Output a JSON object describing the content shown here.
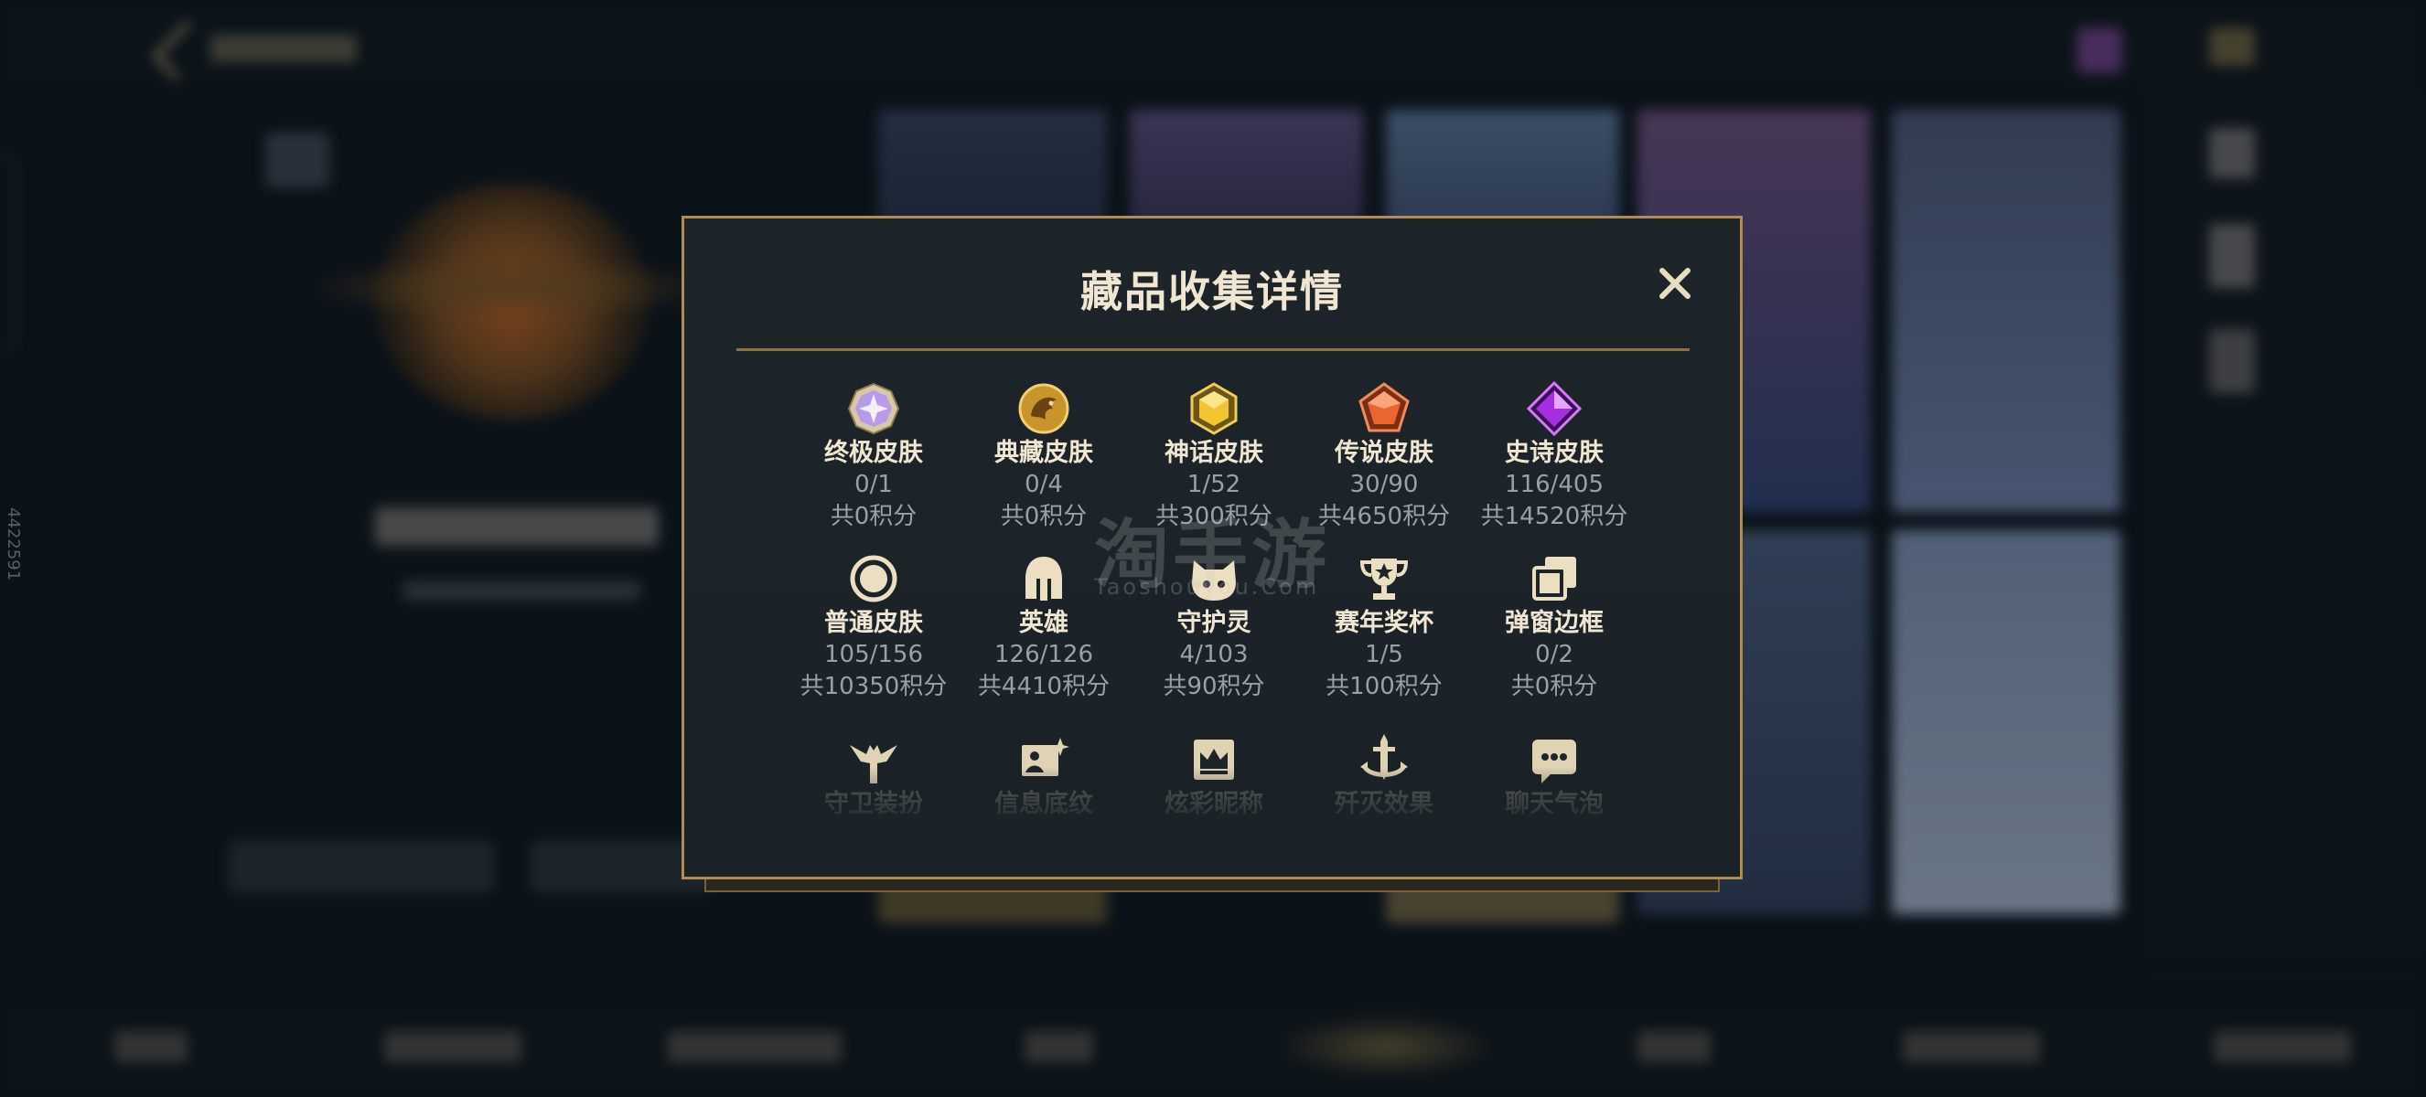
{
  "modal": {
    "title": "藏品收集详情"
  },
  "categories": [
    {
      "name": "终极皮肤",
      "progress": "0/1",
      "points": "共0积分",
      "icon": "ultimate-skin-gem-icon"
    },
    {
      "name": "典藏皮肤",
      "progress": "0/4",
      "points": "共0积分",
      "icon": "dragon-crest-icon"
    },
    {
      "name": "神话皮肤",
      "progress": "1/52",
      "points": "共300积分",
      "icon": "mythic-gem-icon"
    },
    {
      "name": "传说皮肤",
      "progress": "30/90",
      "points": "共4650积分",
      "icon": "legendary-gem-icon"
    },
    {
      "name": "史诗皮肤",
      "progress": "116/405",
      "points": "共14520积分",
      "icon": "epic-gem-icon"
    },
    {
      "name": "普通皮肤",
      "progress": "105/156",
      "points": "共10350积分",
      "icon": "ring-icon"
    },
    {
      "name": "英雄",
      "progress": "126/126",
      "points": "共4410积分",
      "icon": "helmet-icon"
    },
    {
      "name": "守护灵",
      "progress": "4/103",
      "points": "共90积分",
      "icon": "little-legend-icon"
    },
    {
      "name": "赛年奖杯",
      "progress": "1/5",
      "points": "共100积分",
      "icon": "trophy-icon"
    },
    {
      "name": "弹窗边框",
      "progress": "0/2",
      "points": "共0积分",
      "icon": "stacked-frames-icon"
    },
    {
      "name": "守卫装扮",
      "icon": "ward-skin-icon"
    },
    {
      "name": "信息底纹",
      "icon": "banner-sparkle-icon"
    },
    {
      "name": "炫彩昵称",
      "icon": "crown-card-icon"
    },
    {
      "name": "歼灭效果",
      "icon": "anchor-sword-icon"
    },
    {
      "name": "聊天气泡",
      "icon": "chat-bubble-icon"
    }
  ],
  "watermark": {
    "cn": "淘手游",
    "en": "Taoshouyou.Com"
  },
  "side_number": "4422591",
  "colors": {
    "accent_gold": "#b08d4f",
    "title_text": "#f0e6d2",
    "muted_text": "#9aa0a6",
    "modal_bg": "#1d252b"
  }
}
